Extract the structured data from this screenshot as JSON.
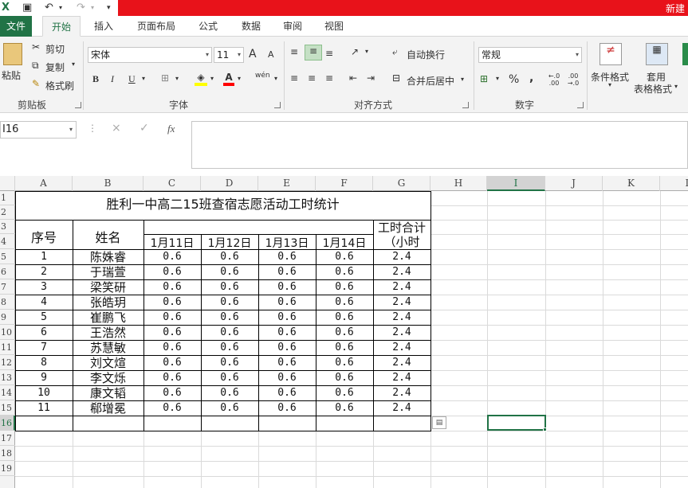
{
  "window": {
    "title": "新建",
    "quick_access": {
      "app_icon": "excel-icon",
      "save_icon": "save-icon",
      "undo_icon": "undo-icon",
      "redo_icon": "redo-icon"
    },
    "brand_color": "#217346",
    "title_bar_color": "#e8121a"
  },
  "ribbon": {
    "tabs": [
      "文件",
      "开始",
      "插入",
      "页面布局",
      "公式",
      "数据",
      "审阅",
      "视图"
    ],
    "active_tab": "开始",
    "clipboard": {
      "paste": "粘贴",
      "cut": "剪切",
      "copy": "复制",
      "format_painter": "格式刷",
      "group": "剪贴板"
    },
    "font": {
      "name": "宋体",
      "size": "11",
      "grow": "A",
      "shrink": "A",
      "bold": "B",
      "italic": "I",
      "underline": "U",
      "font_color_icon": "A",
      "phonetic": "wén",
      "group": "字体"
    },
    "alignment": {
      "wrap_text": "自动换行",
      "merge_center": "合并后居中",
      "group": "对齐方式"
    },
    "number": {
      "format": "常规",
      "percent": "%",
      "comma": ",",
      "inc_decimal": "←.0 .00",
      "dec_decimal": ".00 →.0",
      "group": "数字"
    },
    "styles": {
      "conditional_format": "条件格式",
      "table_format_line1": "套用",
      "table_format_line2": "表格格式"
    }
  },
  "formula_bar": {
    "name_box": "I16",
    "cancel": "×",
    "enter": "✓",
    "fx": "fx",
    "value": ""
  },
  "grid": {
    "columns": [
      "A",
      "B",
      "C",
      "D",
      "E",
      "F",
      "G",
      "H",
      "I",
      "J",
      "K",
      "L"
    ],
    "rows": [
      "1",
      "2",
      "3",
      "4",
      "5",
      "6",
      "7",
      "8",
      "9",
      "10",
      "11",
      "12",
      "13",
      "14",
      "15",
      "16",
      "17",
      "18",
      "19"
    ],
    "selected_column": "I",
    "selected_row": "16"
  },
  "table": {
    "title": "胜利一中高二15班查宿志愿活动工时统计",
    "header_index": "序号",
    "header_name": "姓名",
    "header_total_line1": "工时合计",
    "header_total_line2": "（小时",
    "dates": [
      "1月11日",
      "1月12日",
      "1月13日",
      "1月14日"
    ],
    "rows": [
      {
        "idx": "1",
        "name": "陈姝睿",
        "d1": "0.6",
        "d2": "0.6",
        "d3": "0.6",
        "d4": "0.6",
        "total": "2.4"
      },
      {
        "idx": "2",
        "name": "于瑞萱",
        "d1": "0.6",
        "d2": "0.6",
        "d3": "0.6",
        "d4": "0.6",
        "total": "2.4"
      },
      {
        "idx": "3",
        "name": "梁笑研",
        "d1": "0.6",
        "d2": "0.6",
        "d3": "0.6",
        "d4": "0.6",
        "total": "2.4"
      },
      {
        "idx": "4",
        "name": "张皓玥",
        "d1": "0.6",
        "d2": "0.6",
        "d3": "0.6",
        "d4": "0.6",
        "total": "2.4"
      },
      {
        "idx": "5",
        "name": "崔鹏飞",
        "d1": "0.6",
        "d2": "0.6",
        "d3": "0.6",
        "d4": "0.6",
        "total": "2.4"
      },
      {
        "idx": "6",
        "name": "王浩然",
        "d1": "0.6",
        "d2": "0.6",
        "d3": "0.6",
        "d4": "0.6",
        "total": "2.4"
      },
      {
        "idx": "7",
        "name": "苏慧敏",
        "d1": "0.6",
        "d2": "0.6",
        "d3": "0.6",
        "d4": "0.6",
        "total": "2.4"
      },
      {
        "idx": "8",
        "name": "刘文煊",
        "d1": "0.6",
        "d2": "0.6",
        "d3": "0.6",
        "d4": "0.6",
        "total": "2.4"
      },
      {
        "idx": "9",
        "name": "李文烁",
        "d1": "0.6",
        "d2": "0.6",
        "d3": "0.6",
        "d4": "0.6",
        "total": "2.4"
      },
      {
        "idx": "10",
        "name": "康文韬",
        "d1": "0.6",
        "d2": "0.6",
        "d3": "0.6",
        "d4": "0.6",
        "total": "2.4"
      },
      {
        "idx": "11",
        "name": "郗增冕",
        "d1": "0.6",
        "d2": "0.6",
        "d3": "0.6",
        "d4": "0.6",
        "total": "2.4"
      }
    ]
  }
}
